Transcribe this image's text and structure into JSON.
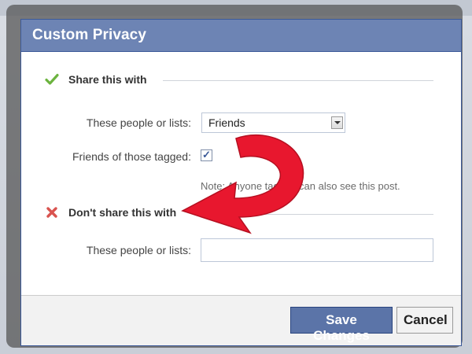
{
  "dialog": {
    "title": "Custom Privacy"
  },
  "share_section": {
    "heading": "Share this with",
    "people_label": "These people or lists:",
    "people_selected": "Friends",
    "tagged_label": "Friends of those tagged:",
    "tagged_checked": true,
    "tagged_mark": "✓",
    "note": "Note: Anyone tagged can also see this post."
  },
  "dont_share_section": {
    "heading": "Don't share this with",
    "people_label": "These people or lists:",
    "people_value": ""
  },
  "footer": {
    "save_label": "Save Changes",
    "cancel_label": "Cancel"
  },
  "colors": {
    "titlebar": "#6d84b4",
    "primary_button": "#5b74a8",
    "arrow": "#e8172e",
    "check_icon": "#6cb33f",
    "x_icon": "#d9534f"
  }
}
